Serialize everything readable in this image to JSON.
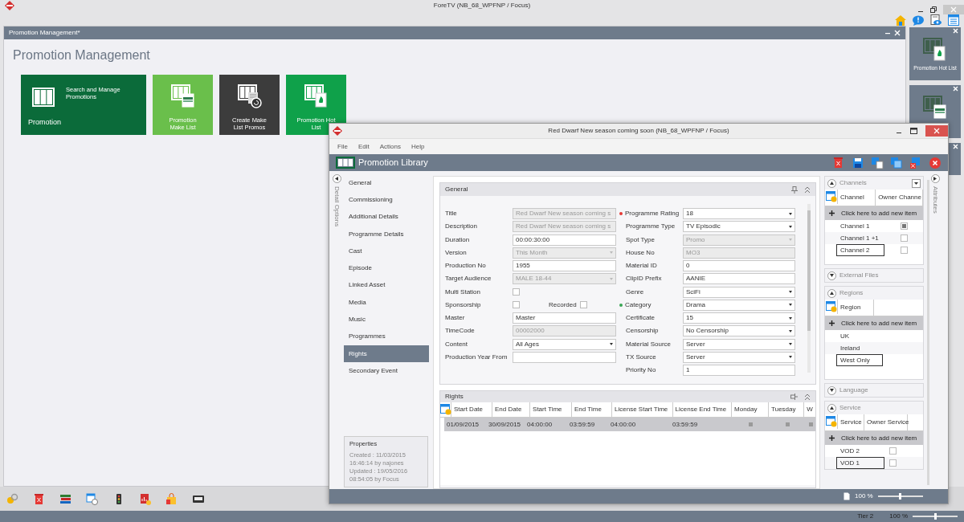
{
  "app": {
    "title": "ForeTV (NB_68_WPFNP / Focus)"
  },
  "document": {
    "tab_title": "Promotion Management*",
    "heading": "Promotion Management",
    "tiles": [
      {
        "kind": "wide",
        "title": "Promotion",
        "subtitle": "Search and Manage Promotions",
        "color": "#0b6b3a"
      },
      {
        "kind": "make-list",
        "title": "Promotion Make List",
        "color": "#6abf4b"
      },
      {
        "kind": "create",
        "title": "Create Make List Promos",
        "color": "#3c3c3c"
      },
      {
        "kind": "hot",
        "title": "Promotion Hot List",
        "color": "#0fa14a"
      }
    ]
  },
  "side_tiles": [
    {
      "kind": "hot",
      "label": "Promotion Hot List"
    },
    {
      "kind": "make-list"
    },
    {
      "kind": "blank"
    }
  ],
  "status_bar": {
    "tier": "Tier 2",
    "zoom": "100 %",
    "zoom_slider": {
      "level": 0.5
    }
  },
  "dialog": {
    "title": "Red Dwarf New season coming soon (NB_68_WPFNP / Focus)",
    "menu": [
      "File",
      "Edit",
      "Actions",
      "Help"
    ],
    "header": "Promotion Library",
    "side_label": "Detail Options",
    "nav": [
      {
        "label": "General",
        "selected": false
      },
      {
        "label": "Commissioning",
        "selected": false
      },
      {
        "label": "Additional Details",
        "selected": false
      },
      {
        "label": "Programme Details",
        "selected": false
      },
      {
        "label": "Cast",
        "selected": false
      },
      {
        "label": "Episode",
        "selected": false
      },
      {
        "label": "Linked Asset",
        "selected": false
      },
      {
        "label": "Media",
        "selected": false
      },
      {
        "label": "Music",
        "selected": false
      },
      {
        "label": "Programmes",
        "selected": false
      },
      {
        "label": "Rights",
        "selected": true
      },
      {
        "label": "Secondary Event",
        "selected": false
      }
    ],
    "properties": {
      "title": "Properties",
      "lines": [
        "Created : 11/03/2015",
        "16:46:14 by najones",
        "Updated : 19/05/2016",
        "08:54:05 by Focus"
      ]
    },
    "general": {
      "title": "General",
      "left_fields": [
        {
          "label": "Title",
          "kind": "text",
          "value": "Red Dwarf New season coming s",
          "disabled": true
        },
        {
          "label": "Description",
          "kind": "text",
          "value": "Red Dwarf New season coming s",
          "disabled": true
        },
        {
          "label": "Duration",
          "kind": "text",
          "value": "00:00:30:00",
          "disabled": false
        },
        {
          "label": "Version",
          "kind": "select",
          "value": "This Month",
          "disabled": true
        },
        {
          "label": "Production No",
          "kind": "text",
          "value": "1955",
          "disabled": false
        },
        {
          "label": "Target Audience",
          "kind": "select",
          "value": "MALE 18-44",
          "disabled": true
        },
        {
          "label": "Multi Station",
          "kind": "check",
          "checked": false
        },
        {
          "label": "Sponsorship",
          "kind": "check",
          "checked": false,
          "second_label": "Recorded",
          "second_checked": false
        },
        {
          "label": "Master",
          "kind": "text",
          "value": "Master",
          "disabled": false
        },
        {
          "label": "TimeCode",
          "kind": "text",
          "value": "00002000",
          "disabled": true
        },
        {
          "label": "Content",
          "kind": "select",
          "value": "All Ages",
          "disabled": false
        },
        {
          "label": "Production Year From",
          "kind": "text",
          "disabled": false
        }
      ],
      "right_fields": [
        {
          "label": "Programme Rating",
          "kind": "select",
          "value": "18",
          "disabled": false,
          "color": "#e53935"
        },
        {
          "label": "Programme Type",
          "kind": "select",
          "value": "TV Episodic",
          "disabled": false
        },
        {
          "label": "Spot Type",
          "kind": "select",
          "value": "Promo",
          "disabled": true
        },
        {
          "label": "House No",
          "kind": "text",
          "value": "MO3",
          "disabled": true
        },
        {
          "label": "Material ID",
          "kind": "text",
          "value": "0",
          "disabled": false
        },
        {
          "label": "ClipID Prefix",
          "kind": "text",
          "value": "AANIE",
          "disabled": false
        },
        {
          "label": "Genre",
          "kind": "select",
          "value": "SciFi",
          "disabled": false
        },
        {
          "label": "Category",
          "kind": "select",
          "value": "Drama",
          "disabled": false,
          "color": "#3aa655"
        },
        {
          "label": "Certificate",
          "kind": "select",
          "value": "15",
          "disabled": false
        },
        {
          "label": "Censorship",
          "kind": "select",
          "value": "No Censorship",
          "disabled": false
        },
        {
          "label": "Material Source",
          "kind": "select",
          "value": "Server",
          "disabled": false
        },
        {
          "label": "TX Source",
          "kind": "select",
          "value": "Server",
          "disabled": false
        },
        {
          "label": "Priority No",
          "kind": "text",
          "value": "1",
          "disabled": false
        }
      ]
    },
    "rights": {
      "title": "Rights",
      "columns": [
        "Start Date",
        "End Date",
        "Start Time",
        "End Time",
        "License Start Time",
        "License End Time",
        "Monday",
        "Tuesday",
        "W"
      ],
      "rows": [
        {
          "selected": true,
          "cells": [
            "01/09/2015",
            "30/09/2015",
            "04:00:00",
            "03:59:59",
            "04:00:00",
            "03:59:59"
          ],
          "checks": [
            false,
            false,
            false
          ]
        }
      ]
    },
    "panels": [
      {
        "title": "Channels",
        "expanded": true,
        "kind": "checklist",
        "has_menu": true,
        "columns": [
          "Channel",
          "Owner Channe"
        ],
        "add_text": "Click here to add new item",
        "rows": [
          {
            "name": "Channel 1",
            "checked": true,
            "focused": false
          },
          {
            "name": "Channel 1 +1",
            "checked": false,
            "focused": false
          },
          {
            "name": "Channel 2",
            "checked": false,
            "focused": true
          }
        ]
      },
      {
        "title": "External Files",
        "expanded": false
      },
      {
        "title": "Regions",
        "expanded": true,
        "kind": "list",
        "columns": [
          "Region"
        ],
        "add_text": "Click here to add new item",
        "rows": [
          {
            "name": "UK",
            "focused": false
          },
          {
            "name": "Ireland",
            "focused": false
          },
          {
            "name": "West Only",
            "focused": true
          }
        ]
      },
      {
        "title": "Language",
        "expanded": false
      },
      {
        "title": "Service",
        "expanded": true,
        "kind": "checklist",
        "columns": [
          "Service",
          "Owner Service"
        ],
        "add_text": "Click here to add new item",
        "rows": [
          {
            "name": "VOD 2",
            "checked": false,
            "focused": false
          },
          {
            "name": "VOD 1",
            "checked": false,
            "focused": true
          }
        ]
      }
    ],
    "attributes_label": "Attributes",
    "zoom": "100 %",
    "zoom_slider": {
      "level": 0.5
    }
  }
}
